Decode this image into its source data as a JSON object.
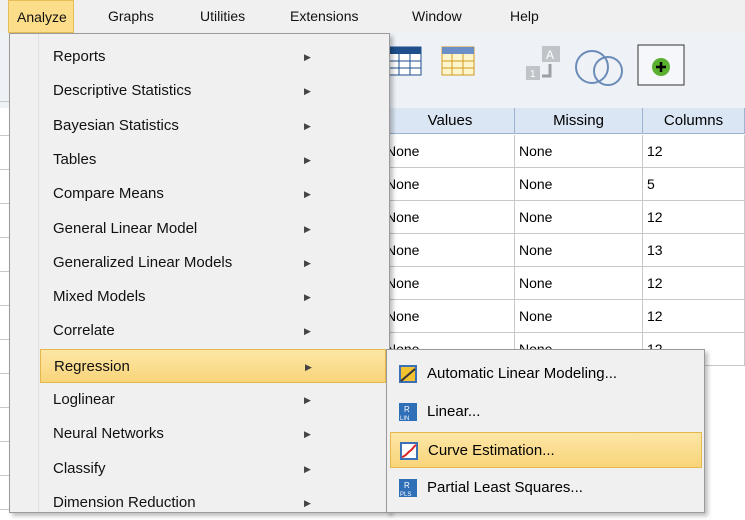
{
  "menubar": {
    "items": [
      {
        "label": "Analyze",
        "active": true
      },
      {
        "label": "Graphs"
      },
      {
        "label": "Utilities"
      },
      {
        "label": "Extensions"
      },
      {
        "label": "Window"
      },
      {
        "label": "Help"
      }
    ]
  },
  "toolbar": {
    "icons": [
      "variables-grid-icon",
      "data-grid-icon",
      "value-labels-icon",
      "venn-sets-icon",
      "add-on-icon"
    ]
  },
  "grid": {
    "columns": [
      "Values",
      "Missing",
      "Columns"
    ],
    "rows": [
      [
        "None",
        "None",
        "12"
      ],
      [
        "None",
        "None",
        "5"
      ],
      [
        "None",
        "None",
        "12"
      ],
      [
        "None",
        "None",
        "13"
      ],
      [
        "None",
        "None",
        "12"
      ],
      [
        "None",
        "None",
        "12"
      ],
      [
        "None",
        "None",
        "12"
      ]
    ]
  },
  "analyze_menu": {
    "items": [
      {
        "label": "Reports"
      },
      {
        "label": "Descriptive Statistics"
      },
      {
        "label": "Bayesian Statistics"
      },
      {
        "label": "Tables"
      },
      {
        "label": "Compare Means"
      },
      {
        "label": "General Linear Model"
      },
      {
        "label": "Generalized Linear Models"
      },
      {
        "label": "Mixed Models"
      },
      {
        "label": "Correlate"
      },
      {
        "label": "Regression",
        "selected": true
      },
      {
        "label": "Loglinear"
      },
      {
        "label": "Neural Networks"
      },
      {
        "label": "Classify"
      },
      {
        "label": "Dimension Reduction"
      }
    ],
    "arrow": "▶"
  },
  "regression_submenu": {
    "items": [
      {
        "label": "Automatic Linear Modeling...",
        "icon": "automatic-linear-modeling-icon"
      },
      {
        "label": "Linear...",
        "icon": "linear-regression-icon"
      },
      {
        "label": "Curve Estimation...",
        "icon": "curve-estimation-icon",
        "selected": true
      },
      {
        "label": "Partial Least Squares...",
        "icon": "partial-least-squares-icon"
      }
    ]
  }
}
